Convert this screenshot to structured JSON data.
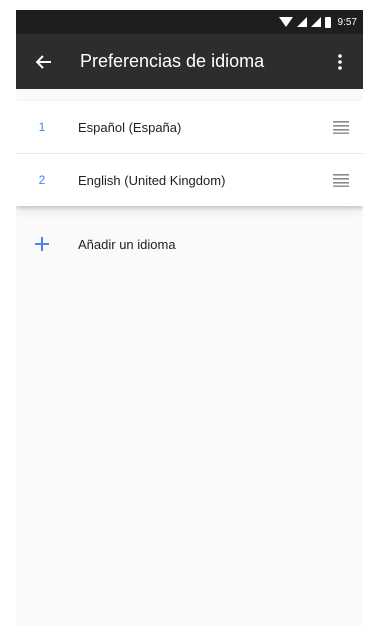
{
  "status_bar": {
    "time": "9:57"
  },
  "app_bar": {
    "title": "Preferencias de idioma"
  },
  "languages": [
    {
      "number": "1",
      "name": "Español (España)"
    },
    {
      "number": "2",
      "name": "English (United Kingdom)"
    }
  ],
  "add_language": {
    "label": "Añadir un idioma"
  },
  "colors": {
    "accent": "#4285f4",
    "app_bar": "#2d2d2d",
    "status_bar": "#1e1e1e"
  }
}
